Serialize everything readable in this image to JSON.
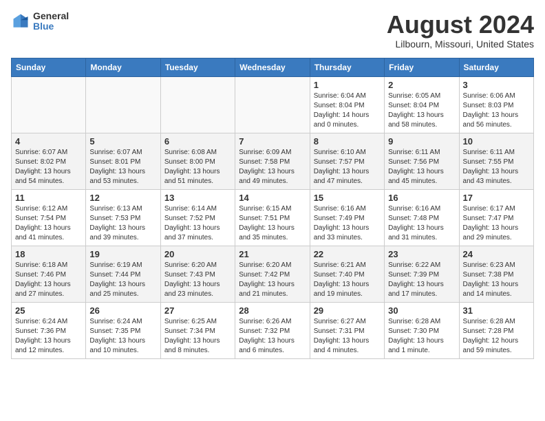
{
  "logo": {
    "general": "General",
    "blue": "Blue"
  },
  "title": {
    "month_year": "August 2024",
    "location": "Lilbourn, Missouri, United States"
  },
  "weekdays": [
    "Sunday",
    "Monday",
    "Tuesday",
    "Wednesday",
    "Thursday",
    "Friday",
    "Saturday"
  ],
  "weeks": [
    [
      {
        "day": "",
        "info": ""
      },
      {
        "day": "",
        "info": ""
      },
      {
        "day": "",
        "info": ""
      },
      {
        "day": "",
        "info": ""
      },
      {
        "day": "1",
        "info": "Sunrise: 6:04 AM\nSunset: 8:04 PM\nDaylight: 14 hours\nand 0 minutes."
      },
      {
        "day": "2",
        "info": "Sunrise: 6:05 AM\nSunset: 8:04 PM\nDaylight: 13 hours\nand 58 minutes."
      },
      {
        "day": "3",
        "info": "Sunrise: 6:06 AM\nSunset: 8:03 PM\nDaylight: 13 hours\nand 56 minutes."
      }
    ],
    [
      {
        "day": "4",
        "info": "Sunrise: 6:07 AM\nSunset: 8:02 PM\nDaylight: 13 hours\nand 54 minutes."
      },
      {
        "day": "5",
        "info": "Sunrise: 6:07 AM\nSunset: 8:01 PM\nDaylight: 13 hours\nand 53 minutes."
      },
      {
        "day": "6",
        "info": "Sunrise: 6:08 AM\nSunset: 8:00 PM\nDaylight: 13 hours\nand 51 minutes."
      },
      {
        "day": "7",
        "info": "Sunrise: 6:09 AM\nSunset: 7:58 PM\nDaylight: 13 hours\nand 49 minutes."
      },
      {
        "day": "8",
        "info": "Sunrise: 6:10 AM\nSunset: 7:57 PM\nDaylight: 13 hours\nand 47 minutes."
      },
      {
        "day": "9",
        "info": "Sunrise: 6:11 AM\nSunset: 7:56 PM\nDaylight: 13 hours\nand 45 minutes."
      },
      {
        "day": "10",
        "info": "Sunrise: 6:11 AM\nSunset: 7:55 PM\nDaylight: 13 hours\nand 43 minutes."
      }
    ],
    [
      {
        "day": "11",
        "info": "Sunrise: 6:12 AM\nSunset: 7:54 PM\nDaylight: 13 hours\nand 41 minutes."
      },
      {
        "day": "12",
        "info": "Sunrise: 6:13 AM\nSunset: 7:53 PM\nDaylight: 13 hours\nand 39 minutes."
      },
      {
        "day": "13",
        "info": "Sunrise: 6:14 AM\nSunset: 7:52 PM\nDaylight: 13 hours\nand 37 minutes."
      },
      {
        "day": "14",
        "info": "Sunrise: 6:15 AM\nSunset: 7:51 PM\nDaylight: 13 hours\nand 35 minutes."
      },
      {
        "day": "15",
        "info": "Sunrise: 6:16 AM\nSunset: 7:49 PM\nDaylight: 13 hours\nand 33 minutes."
      },
      {
        "day": "16",
        "info": "Sunrise: 6:16 AM\nSunset: 7:48 PM\nDaylight: 13 hours\nand 31 minutes."
      },
      {
        "day": "17",
        "info": "Sunrise: 6:17 AM\nSunset: 7:47 PM\nDaylight: 13 hours\nand 29 minutes."
      }
    ],
    [
      {
        "day": "18",
        "info": "Sunrise: 6:18 AM\nSunset: 7:46 PM\nDaylight: 13 hours\nand 27 minutes."
      },
      {
        "day": "19",
        "info": "Sunrise: 6:19 AM\nSunset: 7:44 PM\nDaylight: 13 hours\nand 25 minutes."
      },
      {
        "day": "20",
        "info": "Sunrise: 6:20 AM\nSunset: 7:43 PM\nDaylight: 13 hours\nand 23 minutes."
      },
      {
        "day": "21",
        "info": "Sunrise: 6:20 AM\nSunset: 7:42 PM\nDaylight: 13 hours\nand 21 minutes."
      },
      {
        "day": "22",
        "info": "Sunrise: 6:21 AM\nSunset: 7:40 PM\nDaylight: 13 hours\nand 19 minutes."
      },
      {
        "day": "23",
        "info": "Sunrise: 6:22 AM\nSunset: 7:39 PM\nDaylight: 13 hours\nand 17 minutes."
      },
      {
        "day": "24",
        "info": "Sunrise: 6:23 AM\nSunset: 7:38 PM\nDaylight: 13 hours\nand 14 minutes."
      }
    ],
    [
      {
        "day": "25",
        "info": "Sunrise: 6:24 AM\nSunset: 7:36 PM\nDaylight: 13 hours\nand 12 minutes."
      },
      {
        "day": "26",
        "info": "Sunrise: 6:24 AM\nSunset: 7:35 PM\nDaylight: 13 hours\nand 10 minutes."
      },
      {
        "day": "27",
        "info": "Sunrise: 6:25 AM\nSunset: 7:34 PM\nDaylight: 13 hours\nand 8 minutes."
      },
      {
        "day": "28",
        "info": "Sunrise: 6:26 AM\nSunset: 7:32 PM\nDaylight: 13 hours\nand 6 minutes."
      },
      {
        "day": "29",
        "info": "Sunrise: 6:27 AM\nSunset: 7:31 PM\nDaylight: 13 hours\nand 4 minutes."
      },
      {
        "day": "30",
        "info": "Sunrise: 6:28 AM\nSunset: 7:30 PM\nDaylight: 13 hours\nand 1 minute."
      },
      {
        "day": "31",
        "info": "Sunrise: 6:28 AM\nSunset: 7:28 PM\nDaylight: 12 hours\nand 59 minutes."
      }
    ]
  ]
}
